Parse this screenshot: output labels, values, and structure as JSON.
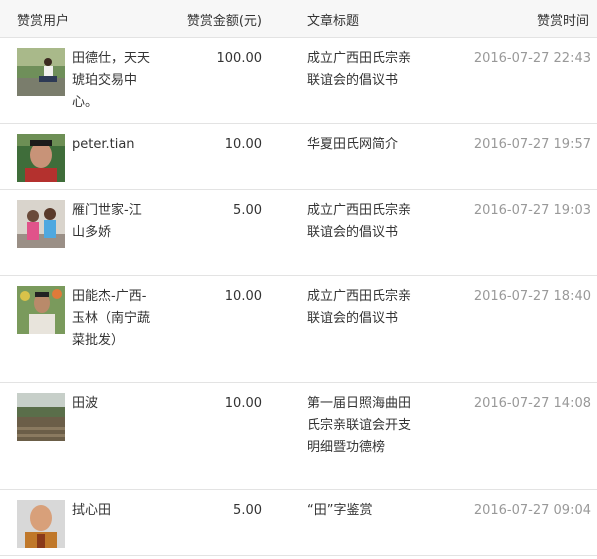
{
  "header": {
    "user": "赞赏用户",
    "amount": "赞赏金额(元)",
    "title": "文章标题",
    "time": "赞赏时间"
  },
  "rows": [
    {
      "name": "田德仕，天天琥珀交易中心。",
      "amount": "100.00",
      "title": "成立广西田氏宗亲联谊会的倡议书",
      "time": "2016-07-27 22:43",
      "avatar": "man-outdoors-photo"
    },
    {
      "name": "peter.tian",
      "amount": "10.00",
      "title": "华夏田氏网简介",
      "time": "2016-07-27 19:57",
      "avatar": "man-portrait-photo"
    },
    {
      "name": "雁门世家-江山多娇",
      "amount": "5.00",
      "title": "成立广西田氏宗亲联谊会的倡议书",
      "time": "2016-07-27 19:03",
      "avatar": "children-photo"
    },
    {
      "name": "田能杰-广西-玉林（南宁蔬菜批发）",
      "amount": "10.00",
      "title": "成立广西田氏宗亲联谊会的倡议书",
      "time": "2016-07-27 18:40",
      "avatar": "man-flowers-photo"
    },
    {
      "name": "田波",
      "amount": "10.00",
      "title": "第一届日照海曲田氏宗亲联谊会开支明细暨功德榜",
      "time": "2016-07-27 14:08",
      "avatar": "landscape-photo"
    },
    {
      "name": "拭心田",
      "amount": "5.00",
      "title": "“田”字鉴赏",
      "time": "2016-07-27 09:04",
      "avatar": "monk-child-photo"
    }
  ]
}
